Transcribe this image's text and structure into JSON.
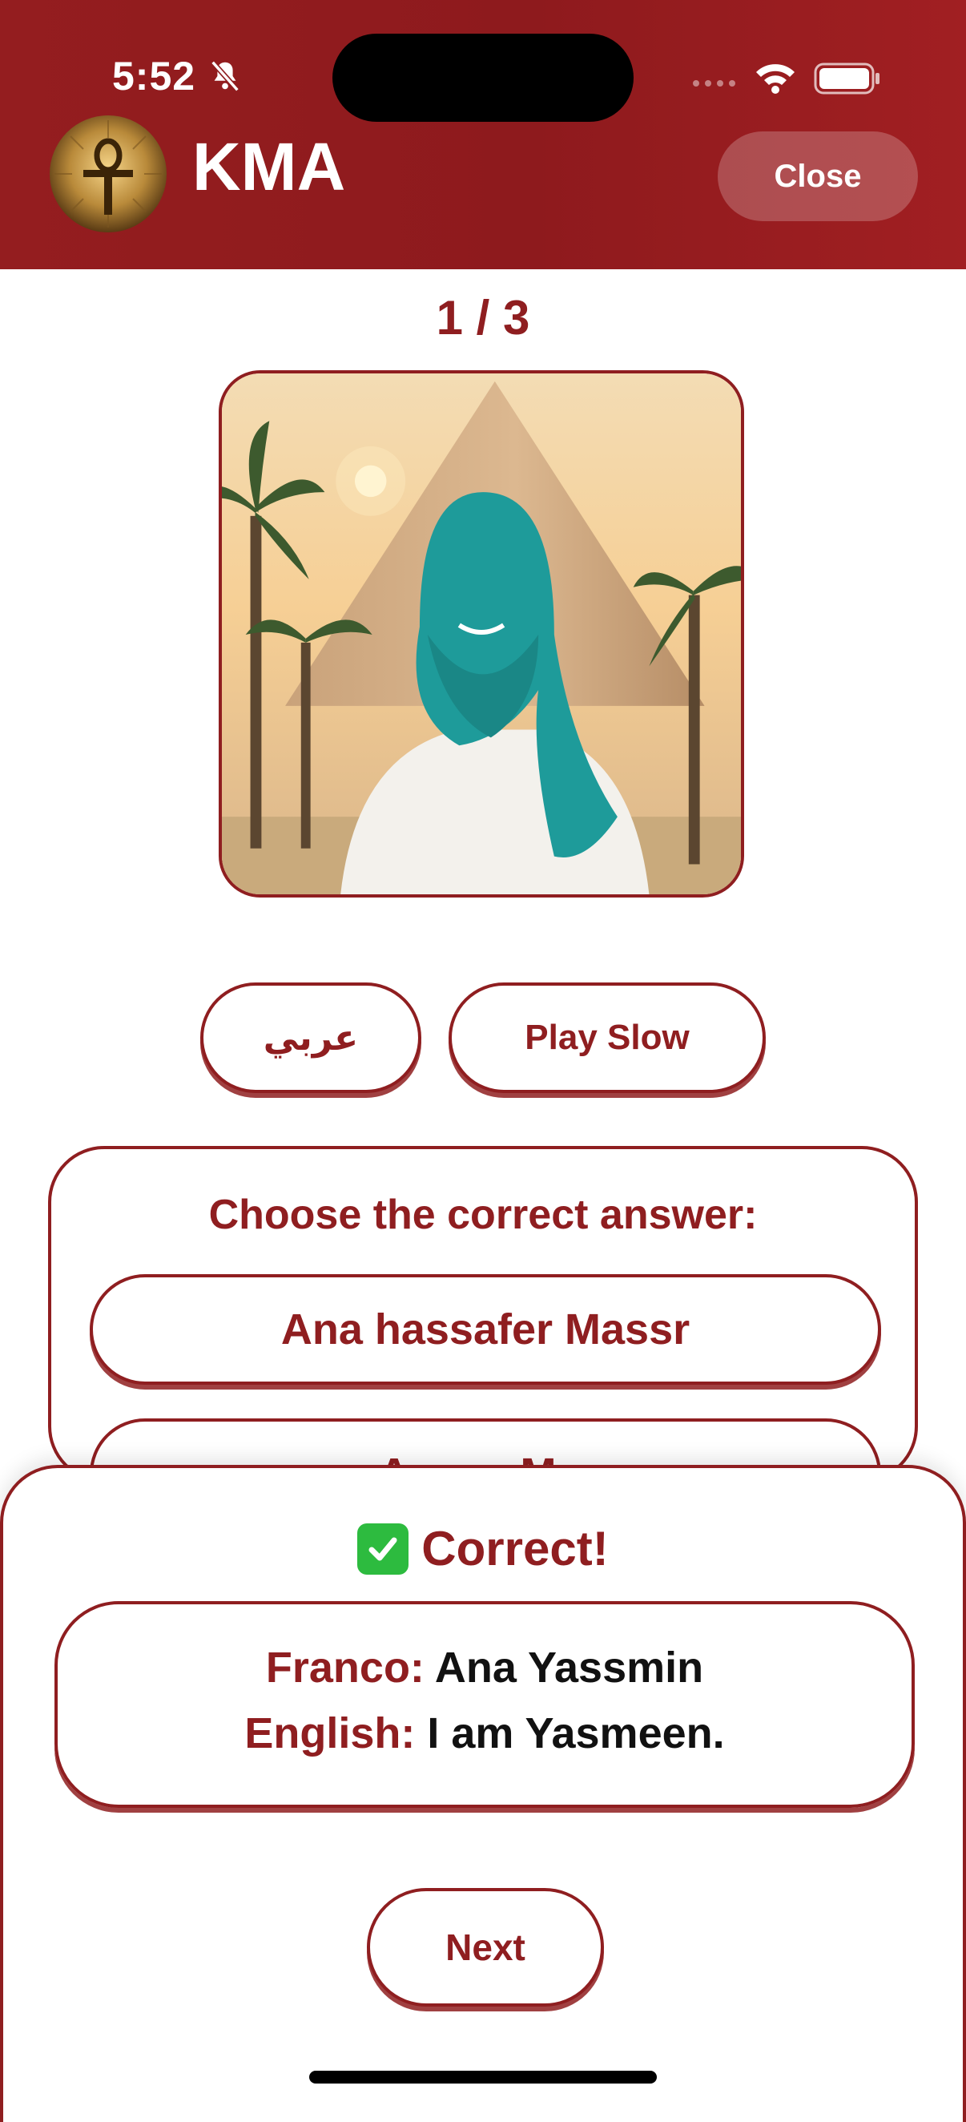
{
  "status_bar": {
    "time": "5:52"
  },
  "header": {
    "app_title": "KMA",
    "close_label": "Close"
  },
  "progress": {
    "counter": "1 / 3"
  },
  "controls": {
    "arabic_label": "عربي",
    "play_slow_label": "Play Slow"
  },
  "question": {
    "prompt": "Choose the correct answer:",
    "answers": [
      "Ana hassafer Massr",
      "Ana ... M..."
    ]
  },
  "result": {
    "title": "Correct!",
    "franco_label": "Franco:",
    "franco_value": "Ana Yassmin",
    "english_label": "English:",
    "english_value": "I am Yasmeen.",
    "next_label": "Next"
  },
  "colors": {
    "brand": "#8f1e20",
    "success": "#2dbb3f"
  }
}
